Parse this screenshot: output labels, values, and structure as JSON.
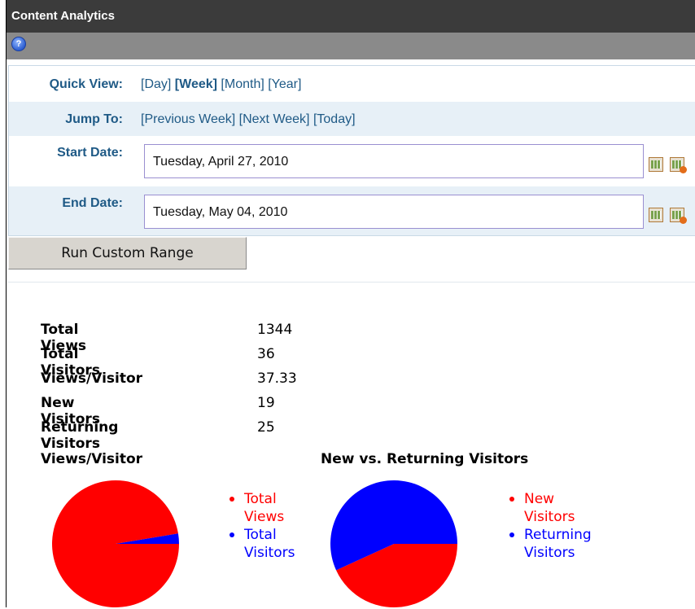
{
  "window": {
    "title": "Content Analytics"
  },
  "toolbar": {
    "help_icon": "help-icon"
  },
  "quick_view": {
    "label": "Quick View:",
    "links": [
      "[Day]",
      "[Week]",
      "[Month]",
      "[Year]"
    ],
    "selected": "[Week]"
  },
  "jump_to": {
    "label": "Jump To:",
    "links": [
      "[Previous Week]",
      "[Next Week]",
      "[Today]"
    ]
  },
  "start_date": {
    "label": "Start Date:",
    "value": "Tuesday, April 27, 2010"
  },
  "end_date": {
    "label": "End Date:",
    "value": "Tuesday, May 04, 2010"
  },
  "run_button": {
    "label": "Run Custom Range"
  },
  "stats": [
    {
      "label": "Total Views",
      "value": "1344"
    },
    {
      "label": "Total Visitors",
      "value": "36"
    },
    {
      "label": "Views/Visitor",
      "value": "37.33"
    },
    {
      "label": "New Visitors",
      "value": "19"
    },
    {
      "label": "Returning Visitors",
      "value": "25"
    }
  ],
  "colors": {
    "series_red": "#ff0000",
    "series_blue": "#0000ff"
  },
  "chart_data": [
    {
      "type": "pie",
      "title": "Views/Visitor",
      "categories": [
        "Total Views",
        "Total Visitors"
      ],
      "values": [
        1344,
        36
      ],
      "colors": [
        "#ff0000",
        "#0000ff"
      ],
      "legend": [
        "Total",
        "Views",
        "Total",
        "Visitors"
      ]
    },
    {
      "type": "pie",
      "title": "New vs. Returning Visitors",
      "categories": [
        "New Visitors",
        "Returning Visitors"
      ],
      "values": [
        19,
        25
      ],
      "colors": [
        "#ff0000",
        "#0000ff"
      ],
      "legend": [
        "New",
        "Visitors",
        "Returning",
        "Visitors"
      ]
    }
  ]
}
